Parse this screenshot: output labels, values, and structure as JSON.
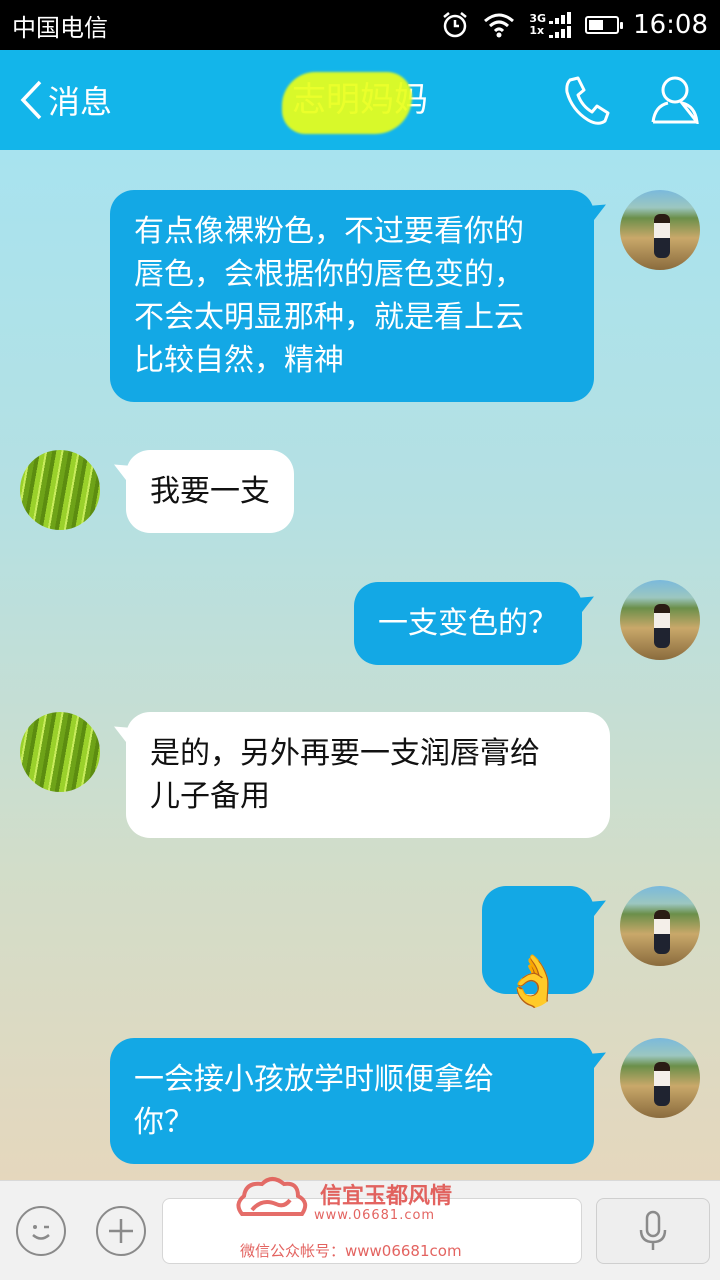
{
  "status_bar": {
    "carrier": "中国电信",
    "network_top": "3G",
    "network_bottom": "1x",
    "time": "16:08",
    "battery_level": 0.55
  },
  "header": {
    "back_label": "消息",
    "title": "志明妈妈",
    "call_icon": "phone-icon",
    "profile_icon": "person-icon"
  },
  "messages": [
    {
      "direction": "out",
      "sender": "self",
      "text": "有点像裸粉色，不过要看你的\n唇色，会根据你的唇色变的，\n不会太明显那种，就是看上云\n比较自然，精神"
    },
    {
      "direction": "in",
      "sender": "other",
      "text": "我要一支"
    },
    {
      "direction": "out",
      "sender": "self",
      "text": "一支变色的？"
    },
    {
      "direction": "in",
      "sender": "other",
      "text": "是的，另外再要一支润唇膏给\n儿子备用"
    },
    {
      "direction": "out",
      "sender": "self",
      "text": "👌",
      "type": "emoji"
    },
    {
      "direction": "out",
      "sender": "self",
      "text": "一会接小孩放学时顺便拿给\n你？"
    }
  ],
  "input_bar": {
    "emoji_icon": "smiley-icon",
    "plus_icon": "plus-icon",
    "voice_icon": "microphone-icon",
    "input_value": ""
  },
  "watermark": {
    "title": "信宜玉都风情",
    "url": "www.06681.com",
    "line": "微信公众帐号：www06681com"
  },
  "colors": {
    "header": "#13b5ea",
    "outgoing_bubble": "#13a8e5",
    "incoming_bubble": "#ffffff",
    "watermark": "#e0534f"
  }
}
